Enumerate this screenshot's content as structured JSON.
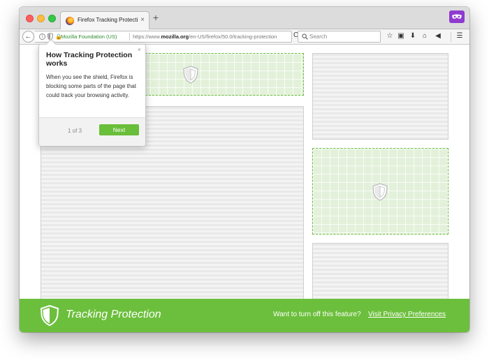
{
  "browser": {
    "tab_title": "Firefox Tracking Protection...",
    "tab_close": "×",
    "new_tab": "+",
    "private_icon": "private-mask-icon"
  },
  "navbar": {
    "back": "←",
    "info": "i",
    "site_identity": "Mozilla Foundation (US)",
    "url_prefix": "https://www.",
    "url_domain": "mozilla.org",
    "url_path": "/en-US/firefox/50.0/tracking-protection",
    "reload": "C",
    "search_placeholder": "Search",
    "toolbar_icons": [
      "bookmark-star-icon",
      "reading-list-icon",
      "download-icon",
      "home-icon",
      "pocket-icon",
      "menu-icon"
    ]
  },
  "popover": {
    "close": "×",
    "title": "How Tracking Protection works",
    "body": "When you see the shield, Firefox is blocking some parts of the page that could track your browsing activity.",
    "step": "1 of 3",
    "next_label": "Next"
  },
  "banner": {
    "title": "Tracking Protection",
    "question": "Want to turn off this feature?",
    "link": "Visit Privacy Preferences"
  },
  "colors": {
    "accent_green": "#6cbf3c",
    "blocked_fill": "#e3f1da",
    "private_purple": "#8f3bd0"
  }
}
